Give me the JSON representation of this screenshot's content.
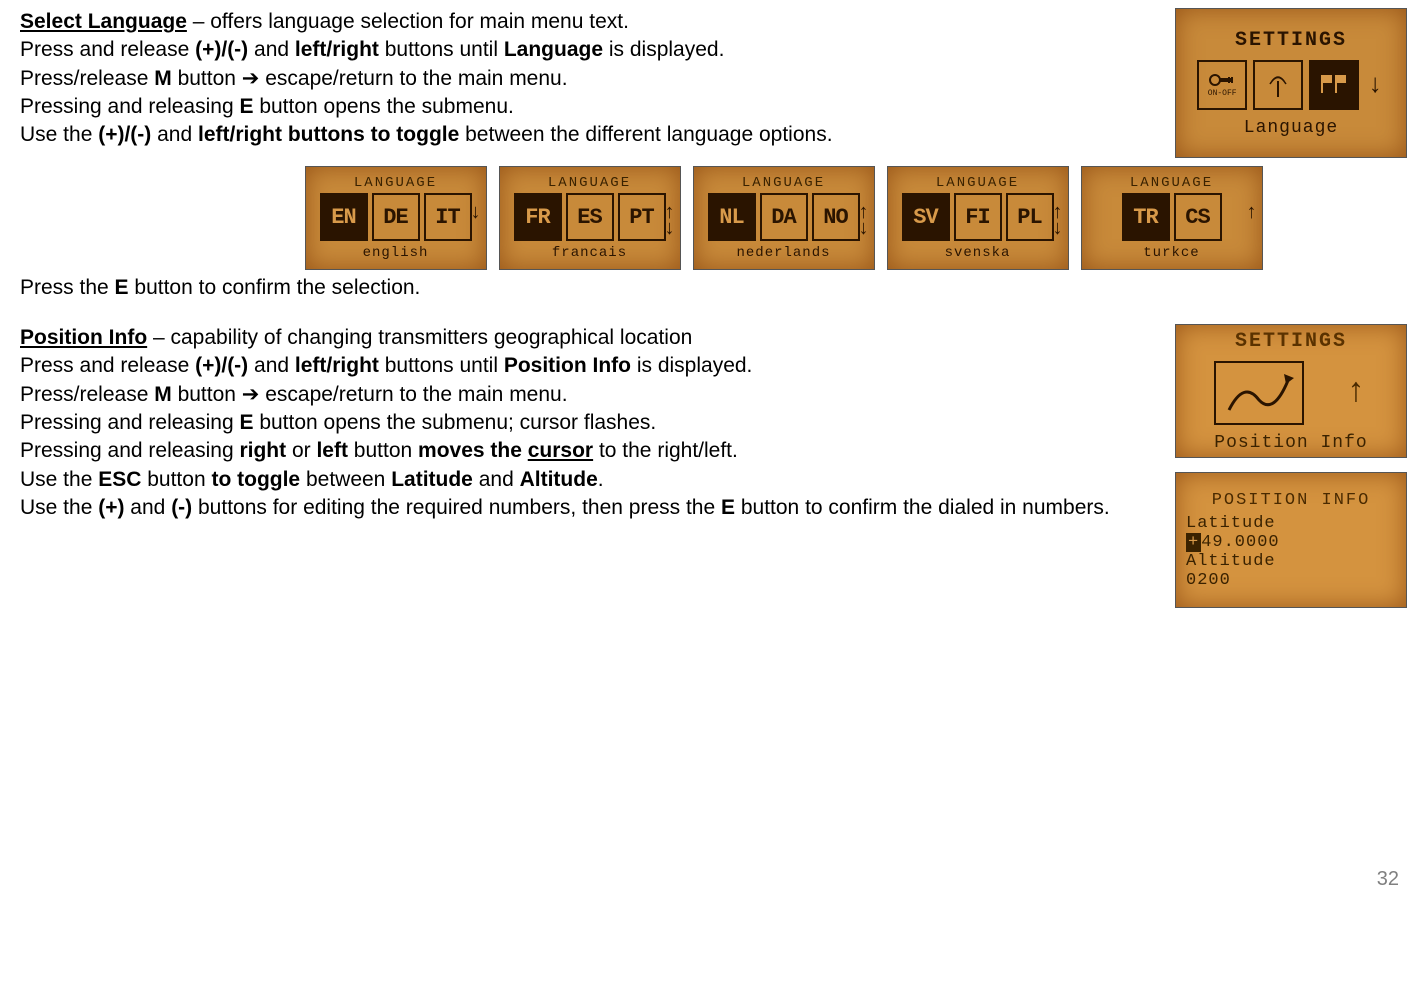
{
  "section1": {
    "title": "Select Language",
    "desc": " – offers language selection for main menu text.",
    "lines": {
      "l1a": "Press and release ",
      "l1b": "(+)/(-)",
      "l1c": " and ",
      "l1d": "left/right",
      "l1e": " buttons until ",
      "l1f": "Language",
      "l1g": " is displayed.",
      "l2a": "Press/release ",
      "l2b": "M",
      "l2c": " button ➔ escape/return to the main menu.",
      "l3a": "Pressing and releasing ",
      "l3b": "E",
      "l3c": " button opens the submenu.",
      "l4a": "Use the ",
      "l4b": "(+)/(-)",
      "l4c": " and ",
      "l4d": "left/right buttons to toggle",
      "l4e": " between the different language options."
    },
    "lcd": {
      "title": "SETTINGS",
      "onoff": "ON-OFF",
      "caption": "Language"
    },
    "langScreens": [
      {
        "title": "LANGUAGE",
        "codes": [
          "EN",
          "DE",
          "IT"
        ],
        "selected": 0,
        "caption": "english",
        "arrows": "down"
      },
      {
        "title": "LANGUAGE",
        "codes": [
          "FR",
          "ES",
          "PT"
        ],
        "selected": 0,
        "caption": "francais",
        "arrows": "both"
      },
      {
        "title": "LANGUAGE",
        "codes": [
          "NL",
          "DA",
          "NO"
        ],
        "selected": 0,
        "caption": "nederlands",
        "arrows": "both"
      },
      {
        "title": "LANGUAGE",
        "codes": [
          "SV",
          "FI",
          "PL"
        ],
        "selected": 0,
        "caption": "svenska",
        "arrows": "both"
      },
      {
        "title": "LANGUAGE",
        "codes": [
          "TR",
          "CS"
        ],
        "selected": 0,
        "caption": "turkce",
        "arrows": "up"
      }
    ],
    "confirm_a": "Press the ",
    "confirm_b": "E",
    "confirm_c": " button to confirm the selection."
  },
  "section2": {
    "title": "Position Info",
    "desc": " – capability of changing transmitters geographical location",
    "lines": {
      "l1a": "Press and release ",
      "l1b": "(+)/(-)",
      "l1c": " and ",
      "l1d": "left/right",
      "l1e": " buttons until ",
      "l1f": "Position Info",
      "l1g": " is displayed.",
      "l2a": "Press/release ",
      "l2b": "M",
      "l2c": " button ➔ escape/return to the main menu.",
      "l3a": "Pressing and releasing ",
      "l3b": "E",
      "l3c": " button opens the submenu; cursor flashes.",
      "l4a": "Pressing and releasing ",
      "l4b": "right",
      "l4c": " or ",
      "l4d": "left",
      "l4e": " button ",
      "l4f": "moves the ",
      "l4g": "cursor",
      "l4h": " to the right/left.",
      "l5a": "Use the ",
      "l5b": "ESC",
      "l5c": " button ",
      "l5d": "to toggle",
      "l5e": " between ",
      "l5f": "Latitude",
      "l5g": " and ",
      "l5h": "Altitude",
      "l5i": ".",
      "l6a": "Use the ",
      "l6b": "(+)",
      "l6c": " and ",
      "l6d": "(-)",
      "l6e": " buttons for editing the required numbers, then press the ",
      "l6f": "E",
      "l6g": " button to confirm the dialed in numbers."
    },
    "lcd_settings": {
      "title": "SETTINGS",
      "caption": "Position Info"
    },
    "lcd_pos": {
      "title": "POSITION INFO",
      "lat_label": "Latitude",
      "lat_sign": "+",
      "lat_val": "49.0000",
      "alt_label": "Altitude",
      "alt_val": "0200"
    }
  },
  "page": "32"
}
